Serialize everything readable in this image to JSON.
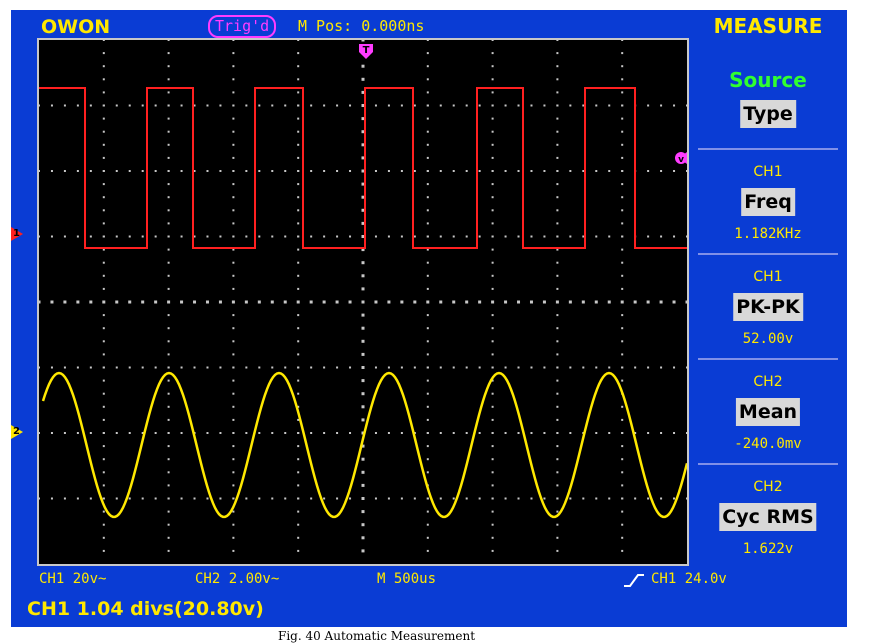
{
  "header": {
    "brand": "OWON",
    "trigger_status": "Trig'd",
    "m_pos": "M Pos: 0.000ns",
    "menu_title": "MEASURE"
  },
  "menu": {
    "source_label": "Source",
    "type_label": "Type",
    "items": [
      {
        "channel": "CH1",
        "type": "Freq",
        "value": "1.182KHz"
      },
      {
        "channel": "CH1",
        "type": "PK-PK",
        "value": "52.00v"
      },
      {
        "channel": "CH2",
        "type": "Mean",
        "value": "-240.0mv"
      },
      {
        "channel": "CH2",
        "type": "Cyc RMS",
        "value": "1.622v"
      }
    ]
  },
  "status": {
    "ch1_scale": "CH1 20v~",
    "ch2_scale": "CH2 2.00v~",
    "timebase": "M 500us",
    "trigger_level": "CH1 24.0v",
    "message": "CH1 1.04 divs(20.80v)"
  },
  "markers": {
    "ch1": "1",
    "ch2": "2",
    "trigger_pos": "T",
    "trigger_level_marker": "v"
  },
  "caption": "Fig. 40 Automatic Measurement",
  "colors": {
    "ch1": "#ff2020",
    "ch2": "#ffe800",
    "background": "#0a3cd4",
    "trigger": "#ff3cff",
    "menu_highlight": "#30ff30"
  }
}
